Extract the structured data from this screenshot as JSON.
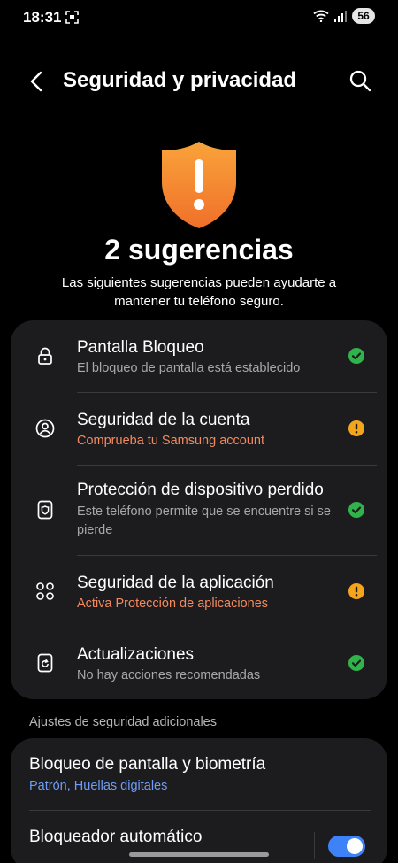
{
  "status_bar": {
    "time": "18:31",
    "battery": "56"
  },
  "header": {
    "title": "Seguridad y privacidad"
  },
  "hero": {
    "title": "2 sugerencias",
    "subtitle": "Las siguientes sugerencias pueden ayudarte a mantener tu teléfono seguro.",
    "shield_color": "#f7892a"
  },
  "items": [
    {
      "title": "Pantalla Bloqueo",
      "subtitle": "El bloqueo de pantalla está establecido",
      "status": "ok",
      "icon": "lock-icon"
    },
    {
      "title": "Seguridad de la cuenta",
      "subtitle": "Comprueba tu Samsung account",
      "status": "warning",
      "icon": "account-icon"
    },
    {
      "title": "Protección de dispositivo perdido",
      "subtitle": "Este teléfono permite que se encuentre si se pierde",
      "status": "ok",
      "icon": "device-shield-icon"
    },
    {
      "title": "Seguridad de la aplicación",
      "subtitle": "Activa Protección de aplicaciones",
      "status": "warning",
      "icon": "apps-icon"
    },
    {
      "title": "Actualizaciones",
      "subtitle": "No hay acciones recomendadas",
      "status": "ok",
      "icon": "update-icon"
    }
  ],
  "colors": {
    "ok": "#2fb34a",
    "warning": "#f4a51c",
    "warning_text": "#f4895f",
    "link": "#6f9df7",
    "toggle_on": "#3e82f7"
  },
  "section_additional": {
    "label": "Ajustes de seguridad adicionales",
    "items": [
      {
        "title": "Bloqueo de pantalla y biometría",
        "subtitle": "Patrón, Huellas digitales"
      },
      {
        "title": "Bloqueador automático",
        "toggle_on": true
      }
    ]
  }
}
